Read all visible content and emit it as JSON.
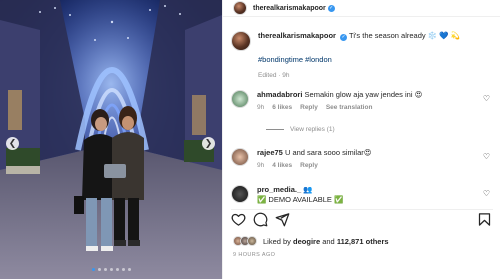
{
  "post_author": {
    "username": "therealkarismakapoor",
    "verified": true
  },
  "carousel": {
    "prev_icon": "chevron-left-icon",
    "next_icon": "chevron-right-icon",
    "dots": 7,
    "active_dot": 0
  },
  "caption": {
    "username": "therealkarismakapoor",
    "text": "Ti's the season already ❄️ 💙 💫",
    "hashtags": "#bondingtime #london",
    "edited": "Edited · 9h"
  },
  "comments": [
    {
      "username": "ahmadabrori",
      "text": "Semakin glow aja yaw jendes ini 😍",
      "time": "9h",
      "likes": "6 likes",
      "reply": "Reply",
      "translate": "See translation",
      "view_replies": "View replies (1)"
    },
    {
      "username": "rajee75",
      "text": "U and sara sooo similar😍",
      "time": "9h",
      "likes": "4 likes",
      "reply": "Reply"
    },
    {
      "username": "pro_media._",
      "emoji": "👥",
      "text": "✅ DEMO AVAILABLE ✅"
    }
  ],
  "actions": {
    "like_icon": "heart-icon",
    "comment_icon": "comment-icon",
    "share_icon": "share-icon",
    "save_icon": "bookmark-icon"
  },
  "likes": {
    "prefix": "Liked by",
    "user": "deogire",
    "and": "and",
    "others": "112,871 others"
  },
  "timestamp": "9 HOURS AGO",
  "colors": {
    "accent": "#3897f0",
    "link": "#00376b",
    "muted": "#8e8e8e",
    "text": "#262626"
  }
}
